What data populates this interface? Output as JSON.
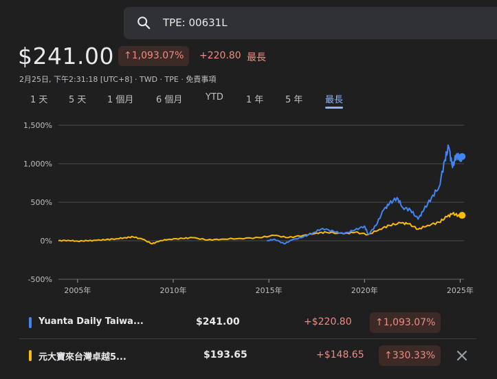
{
  "search": {
    "query": "TPE: 00631L"
  },
  "quote": {
    "price": "$241.00",
    "change_pct": "1,093.07%",
    "change_abs": "+220.80",
    "period_label": "最長",
    "meta": "2月25日, 下午2:31:18 [UTC+8] · TWD · TPE · 免責事項"
  },
  "range_tabs": [
    {
      "label": "1 天"
    },
    {
      "label": "5 天"
    },
    {
      "label": "1 個月"
    },
    {
      "label": "6 個月"
    },
    {
      "label": "YTD"
    },
    {
      "label": "1 年"
    },
    {
      "label": "5 年"
    },
    {
      "label": "最長",
      "active": true
    }
  ],
  "chart_data": {
    "type": "line",
    "y_tick_labels": [
      "1,500%",
      "1,000%",
      "500%",
      "0%",
      "-500%"
    ],
    "y_ticks": [
      1500,
      1000,
      500,
      0,
      -500
    ],
    "ylim": [
      -500,
      1500
    ],
    "x_tick_labels": [
      "2005年",
      "2010年",
      "2015年",
      "2020年",
      "2025年"
    ],
    "x_ticks": [
      2005,
      2010,
      2015,
      2020,
      2025
    ],
    "xlim": [
      2004.0,
      2025.2
    ],
    "grid": true,
    "series": [
      {
        "name": "元大寶來台灣卓越5...",
        "color": "#fbbc04",
        "x": [
          2004.0,
          2004.5,
          2005.0,
          2005.5,
          2006.0,
          2006.5,
          2007.0,
          2007.5,
          2007.9,
          2008.4,
          2008.9,
          2009.3,
          2009.8,
          2010.5,
          2011.0,
          2011.8,
          2012.5,
          2013.5,
          2014.5,
          2015.3,
          2016.0,
          2016.8,
          2017.5,
          2018.0,
          2018.9,
          2019.5,
          2020.2,
          2020.8,
          2021.3,
          2021.9,
          2022.3,
          2022.8,
          2023.3,
          2023.9,
          2024.3,
          2024.6,
          2024.9,
          2025.1
        ],
        "values": [
          0,
          5,
          -5,
          0,
          5,
          15,
          25,
          40,
          50,
          20,
          -40,
          0,
          20,
          30,
          40,
          10,
          20,
          30,
          40,
          70,
          40,
          70,
          100,
          110,
          90,
          110,
          80,
          150,
          200,
          230,
          220,
          150,
          200,
          240,
          310,
          350,
          330,
          330
        ]
      },
      {
        "name": "Yuanta Daily Taiwa...",
        "color": "#4285f4",
        "x": [
          2014.9,
          2015.3,
          2015.8,
          2016.2,
          2016.8,
          2017.3,
          2017.8,
          2018.4,
          2018.9,
          2019.5,
          2020.0,
          2020.2,
          2020.6,
          2021.0,
          2021.3,
          2021.7,
          2022.0,
          2022.4,
          2022.8,
          2023.1,
          2023.5,
          2023.9,
          2024.2,
          2024.4,
          2024.6,
          2024.8,
          2025.0,
          2025.1
        ],
        "values": [
          0,
          20,
          -40,
          10,
          50,
          100,
          160,
          120,
          90,
          140,
          190,
          80,
          200,
          400,
          480,
          560,
          430,
          400,
          280,
          400,
          560,
          700,
          1050,
          1220,
          950,
          1120,
          1060,
          1093
        ]
      }
    ]
  },
  "legend": [
    {
      "name": "Yuanta Daily Taiwa...",
      "color": "#4285f4",
      "price": "$241.00",
      "change_abs": "+$220.80",
      "change_pct": "1,093.07%"
    },
    {
      "name": "元大寶來台灣卓越5...",
      "color": "#fbbc04",
      "price": "$193.65",
      "change_abs": "+$148.65",
      "change_pct": "330.33%"
    }
  ]
}
